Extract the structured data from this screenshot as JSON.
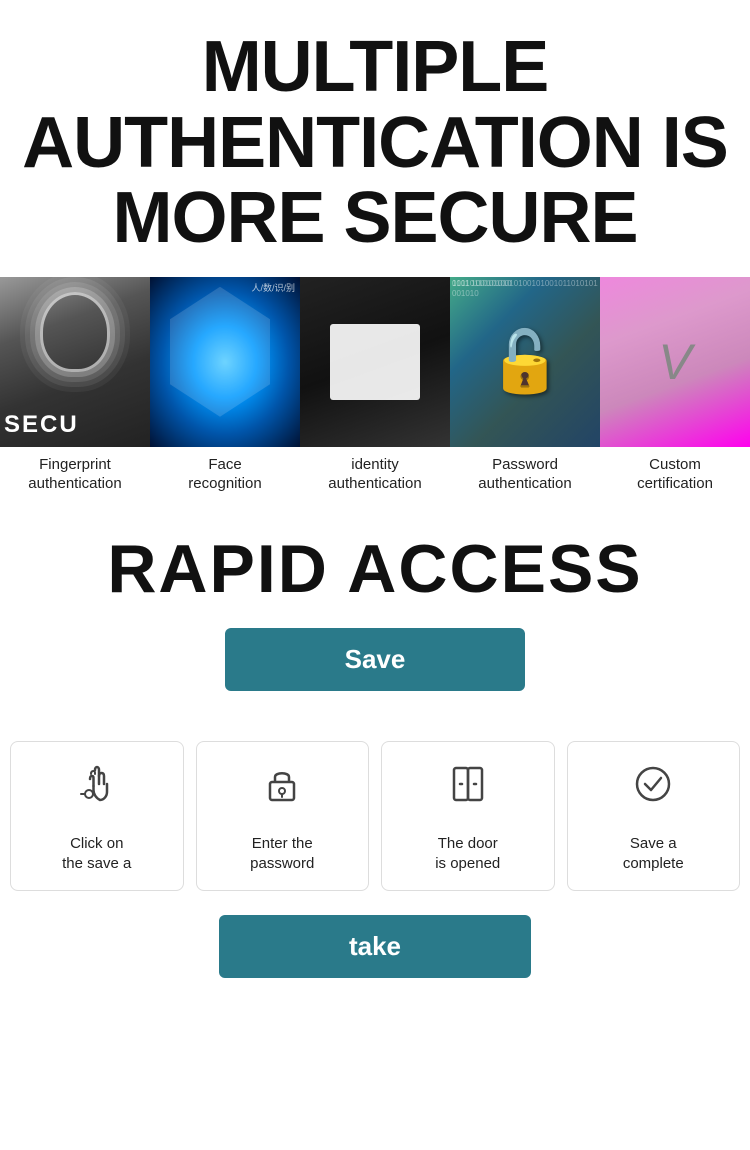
{
  "header": {
    "title_line1": "MULTIPLE",
    "title_line2": "AUTHENTICATION IS",
    "title_line3": "MORE SECURE"
  },
  "images": [
    {
      "id": "fingerprint",
      "label_line1": "Fingerprint",
      "label_line2": "authentication",
      "type": "fingerprint"
    },
    {
      "id": "face",
      "label_line1": "Face",
      "label_line2": "recognition",
      "type": "face"
    },
    {
      "id": "identity",
      "label_line1": "identity",
      "label_line2": "authentication",
      "type": "identity"
    },
    {
      "id": "password",
      "label_line1": "Password",
      "label_line2": "authentication",
      "type": "password"
    },
    {
      "id": "custom",
      "label_line1": "Custom",
      "label_line2": "certification",
      "type": "custom"
    }
  ],
  "rapid": {
    "title": "RAPID ACCESS",
    "save_button": "Save",
    "take_button": "take"
  },
  "steps": [
    {
      "id": "click-save",
      "icon": "finger",
      "label_line1": "Click on",
      "label_line2": "the save a"
    },
    {
      "id": "enter-password",
      "icon": "lock",
      "label_line1": "Enter the",
      "label_line2": "password"
    },
    {
      "id": "door-opened",
      "icon": "door",
      "label_line1": "The door",
      "label_line2": "is opened"
    },
    {
      "id": "save-complete",
      "icon": "check",
      "label_line1": "Save a",
      "label_line2": "complete"
    }
  ]
}
